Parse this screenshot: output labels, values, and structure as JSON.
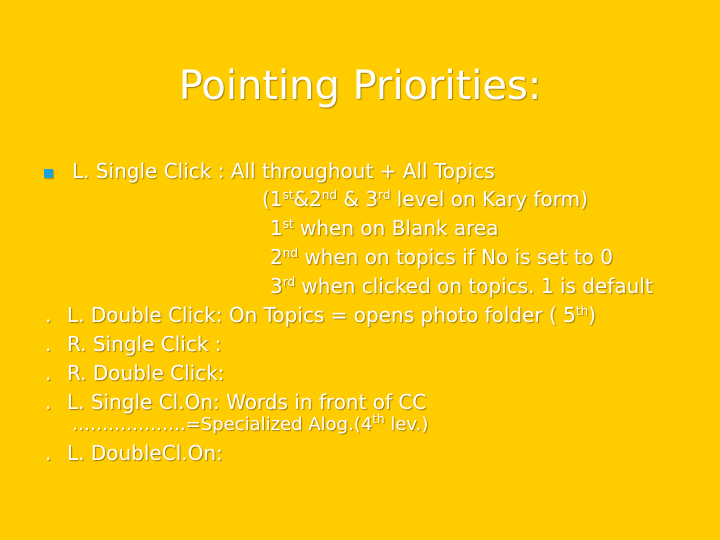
{
  "title": "Pointing Priorities:",
  "lines": {
    "l1": "L. Single Click : All throughout + All Topics",
    "l2": {
      "a": "(1",
      "s1": "st",
      "b": "&2",
      "s2": "nd",
      "c": " & 3",
      "s3": "rd",
      "d": " level on Kary form)"
    },
    "l3": {
      "a": "1",
      "s1": "st",
      "b": " when on Blank area"
    },
    "l4": {
      "a": "2",
      "s1": "nd",
      "b": " when on topics if No is set to 0"
    },
    "l5": {
      "a": "3",
      "s1": "rd",
      "b": " when clicked on topics. 1 is default"
    },
    "l6": {
      "a": "L. Double Click: On Topics = opens photo folder ( 5",
      "s1": "th",
      "b": ")"
    },
    "l7": "R. Single Click :",
    "l8": "R. Double Click:",
    "l9": "L. Single Cl.On: Words in front of CC",
    "l10": {
      "a": "……………….=Specialized Alog.(4",
      "s1": "th",
      "b": " lev.)"
    },
    "l11": "L. DoubleCl.On:"
  },
  "dot_marker": "."
}
